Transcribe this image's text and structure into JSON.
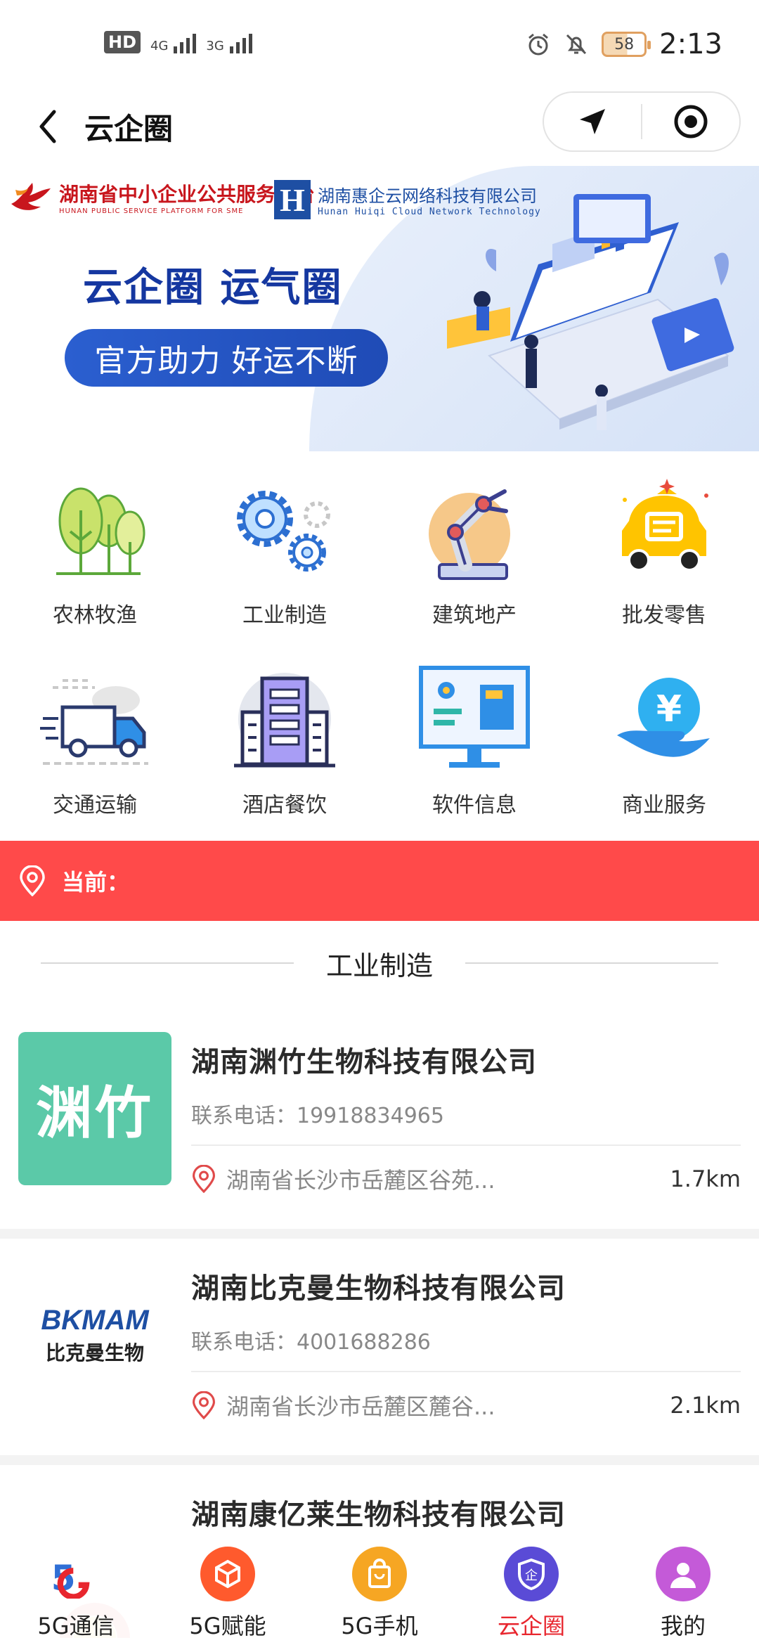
{
  "status_bar": {
    "hd": "HD",
    "net1": "4G",
    "net2": "3G",
    "battery": "58",
    "time": "2:13"
  },
  "nav": {
    "title": "云企圈"
  },
  "banner": {
    "logo1_title": "湖南省中小企业公共服务平台",
    "logo1_sub": "HUNAN PUBLIC SERVICE PLATFORM FOR SME",
    "logo2_mark": "H",
    "logo2_title": "湖南惠企云网络科技有限公司",
    "logo2_sub": "Hunan Huiqi Cloud Network Technology",
    "headline": "云企圈 运气圈",
    "slogan": "官方助力 好运不断"
  },
  "categories": [
    {
      "label": "农林牧渔",
      "icon": "trees-icon"
    },
    {
      "label": "工业制造",
      "icon": "gears-icon"
    },
    {
      "label": "建筑地产",
      "icon": "robot-arm-icon"
    },
    {
      "label": "批发零售",
      "icon": "shopping-cart-icon"
    },
    {
      "label": "交通运输",
      "icon": "truck-icon"
    },
    {
      "label": "酒店餐饮",
      "icon": "building-icon"
    },
    {
      "label": "软件信息",
      "icon": "monitor-icon"
    },
    {
      "label": "商业服务",
      "icon": "yuan-coin-icon"
    }
  ],
  "location": {
    "label": "当前："
  },
  "section": {
    "title": "工业制造"
  },
  "companies": [
    {
      "logo_text": "渊竹",
      "name": "湖南渊竹生物科技有限公司",
      "phone": "联系电话：19918834965",
      "address": "湖南省长沙市岳麓区谷苑...",
      "distance": "1.7km"
    },
    {
      "logo_text": "BKMAM",
      "logo_sub": "比克曼生物",
      "name": "湖南比克曼生物科技有限公司",
      "phone": "联系电话：4001688286",
      "address": "湖南省长沙市岳麓区麓谷...",
      "distance": "2.1km"
    },
    {
      "name": "湖南康亿莱生物科技有限公司"
    }
  ],
  "tabs": [
    {
      "label": "5G通信",
      "color": "#ffffff"
    },
    {
      "label": "5G赋能",
      "color": "#ff5a2d"
    },
    {
      "label": "5G手机",
      "color": "#f6a623"
    },
    {
      "label": "云企圈",
      "color": "#5a4bd6"
    },
    {
      "label": "我的",
      "color": "#c45ad8"
    }
  ],
  "colors": {
    "accent_red": "#ff4a4a",
    "active_tab": "#e8262e",
    "banner_blue": "#1537a0"
  }
}
